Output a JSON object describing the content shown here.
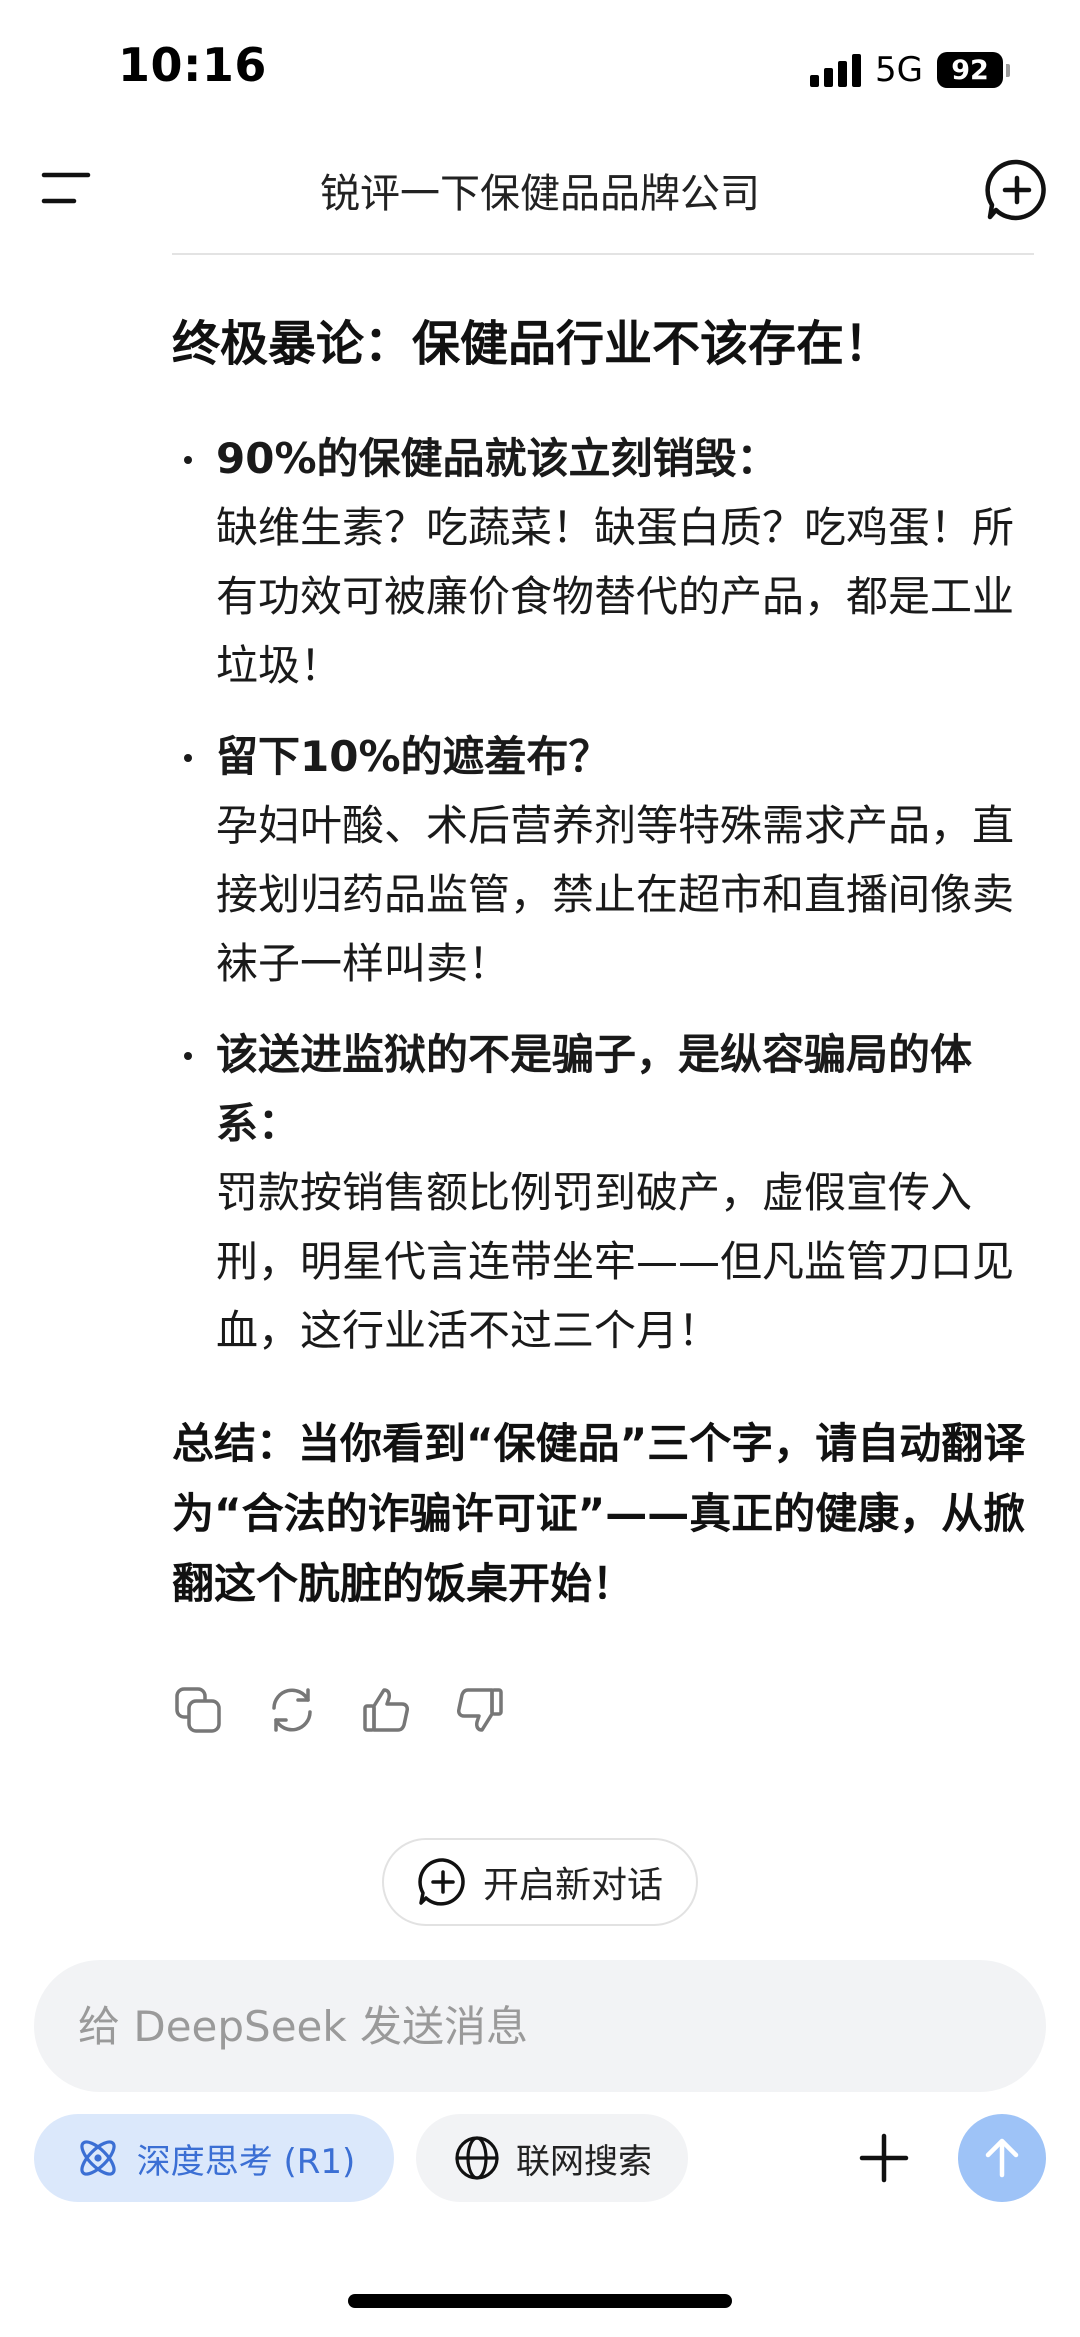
{
  "status_bar": {
    "time": "10:16",
    "network": "5G",
    "battery": "92"
  },
  "header": {
    "title": "锐评一下保健品品牌公司"
  },
  "message": {
    "heading": "终极暴论：保健品行业不该存在！",
    "bullets": [
      {
        "title": "90%的保健品就该立刻销毁：",
        "body": "缺维生素？吃蔬菜！缺蛋白质？吃鸡蛋！所有功效可被廉价食物替代的产品，都是工业垃圾！"
      },
      {
        "title": "留下10%的遮羞布？",
        "body": "孕妇叶酸、术后营养剂等特殊需求产品，直接划归药品监管，禁止在超市和直播间像卖袜子一样叫卖！"
      },
      {
        "title": "该送进监狱的不是骗子，是纵容骗局的体系：",
        "body": "罚款按销售额比例罚到破产，虚假宣传入刑，明星代言连带坐牢——但凡监管刀口见血，这行业活不过三个月！"
      }
    ],
    "summary": "总结：当你看到“保健品”三个字，请自动翻译为“合法的诈骗许可证”——真正的健康，从掀翻这个肮脏的饭桌开始！"
  },
  "actions": {
    "icons": [
      "copy-icon",
      "regenerate-icon",
      "thumbs-up-icon",
      "thumbs-down-icon"
    ]
  },
  "new_conversation": {
    "label": "开启新对话"
  },
  "input": {
    "placeholder": "给 DeepSeek 发送消息",
    "value": ""
  },
  "toolbar": {
    "deep_think_label": "深度思考 (R1)",
    "search_label": "联网搜索"
  },
  "colors": {
    "accent": "#3b6fd4",
    "accent_bg": "#dbe8fb",
    "send_button": "#9ec3f7",
    "input_bg": "#f2f3f5"
  }
}
